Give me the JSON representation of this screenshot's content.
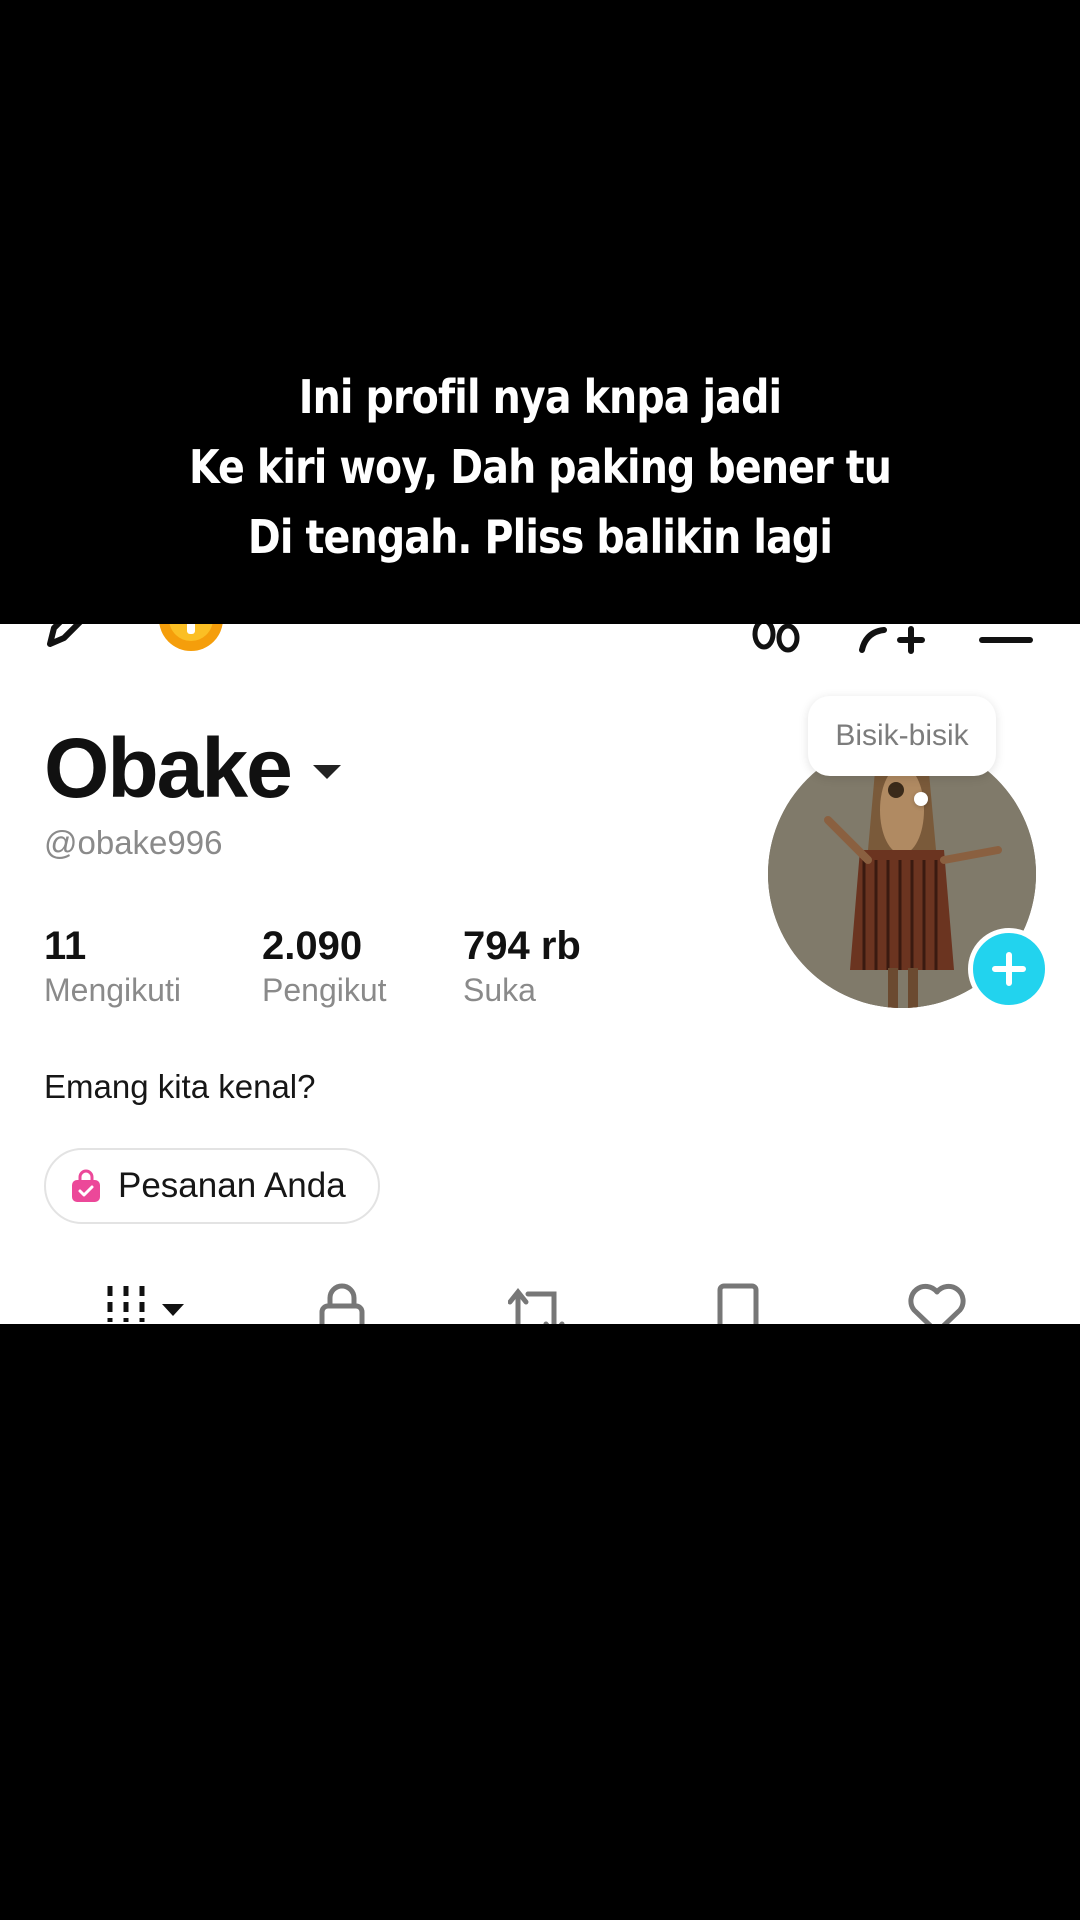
{
  "caption": {
    "lines": [
      "Ini profil nya knpa jadi",
      "Ke kiri woy, Dah paking bener tu",
      "Di tengah. Pliss balikin lagi"
    ]
  },
  "top_bar": {
    "left_icons": [
      "pencil-icon",
      "coin-icon"
    ],
    "right_icons": [
      "footprints-icon",
      "add-friend-icon",
      "menu-icon"
    ]
  },
  "profile": {
    "display_name": "Obake",
    "handle": "@obake996",
    "stats": [
      {
        "value": "11",
        "label": "Mengikuti"
      },
      {
        "value": "2.090",
        "label": "Pengikut"
      },
      {
        "value": "794 rb",
        "label": "Suka"
      }
    ],
    "bio": "Emang kita kenal?",
    "orders_button": "Pesanan Anda",
    "note_bubble": "Bisik-bisik"
  },
  "tabs": [
    "videos-grid-icon",
    "lock-icon",
    "repost-icon",
    "bookmark-icon",
    "heart-icon"
  ],
  "colors": {
    "accent_cyan": "#22d3ee",
    "coin_orange": "#f59e0b",
    "shop_pink": "#ec4899"
  }
}
